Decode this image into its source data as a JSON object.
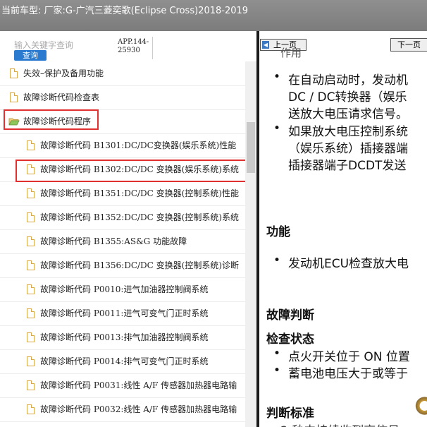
{
  "header": {
    "title": "当前车型:  厂家:G-广汽三菱奕歌(Eclipse Cross)2018-2019"
  },
  "search": {
    "placeholder": "输入关键字查询",
    "button": "查询"
  },
  "app_code": "APP.144-25930",
  "tree": [
    {
      "label": "失效–保护及备用功能",
      "level": 0,
      "kind": "doc"
    },
    {
      "label": "故障诊断代码检查表",
      "level": 0,
      "kind": "doc"
    },
    {
      "label": "故障诊断代码程序",
      "level": 0,
      "kind": "folder-open",
      "highlighted": true
    },
    {
      "label": "故障诊断代码 B1301:DC/DC变换器(娱乐系统)性能",
      "level": 1,
      "kind": "doc"
    },
    {
      "label": "故障诊断代码 B1302:DC/DC 变换器(娱乐系统)系统",
      "level": 1,
      "kind": "doc",
      "highlighted": true
    },
    {
      "label": "故障诊断代码 B1351:DC/DC 变换器(控制系统)性能",
      "level": 1,
      "kind": "doc"
    },
    {
      "label": "故障诊断代码 B1352:DC/DC 变换器(控制系统)系统",
      "level": 1,
      "kind": "doc"
    },
    {
      "label": "故障诊断代码 B1355:AS&G 功能故障",
      "level": 1,
      "kind": "doc"
    },
    {
      "label": "故障诊断代码 B1356:DC/DC 变换器(控制系统)诊断",
      "level": 1,
      "kind": "doc"
    },
    {
      "label": "故障诊断代码 P0010:进气加油器控制阀系统",
      "level": 1,
      "kind": "doc"
    },
    {
      "label": "故障诊断代码 P0011:进气可变气门正时系统",
      "level": 1,
      "kind": "doc"
    },
    {
      "label": "故障诊断代码 P0013:排气加油器控制阀系统",
      "level": 1,
      "kind": "doc"
    },
    {
      "label": "故障诊断代码 P0014:排气可变气门正时系统",
      "level": 1,
      "kind": "doc"
    },
    {
      "label": "故障诊断代码 P0031:线性 A/F 传感器加热器电路输",
      "level": 1,
      "kind": "doc"
    },
    {
      "label": "故障诊断代码 P0032:线性 A/F 传感器加热器电路输",
      "level": 1,
      "kind": "doc"
    }
  ],
  "pager": {
    "prev": "上一页",
    "next": "下一页"
  },
  "doc": {
    "top_partial": "作用",
    "bullets_1": [
      [
        "在自动启动时，发动机",
        "DC / DC转换器（娱乐",
        "送放大电压请求信号。"
      ],
      [
        "如果放大电压控制系统",
        "（娱乐系统）插接器端",
        "插接器端子DCDT发送"
      ]
    ],
    "h_function": "功能",
    "bullet_function": "发动机ECU检查放大电",
    "h_judge": "故障判断",
    "h_check": "检查状态",
    "bullets_check": [
      "点火开关位于 ON 位置",
      "蓄电池电压大于或等于"
    ],
    "h_criteria": "判断标准",
    "bottom_partial": "2 秒内持续收到高信号"
  }
}
